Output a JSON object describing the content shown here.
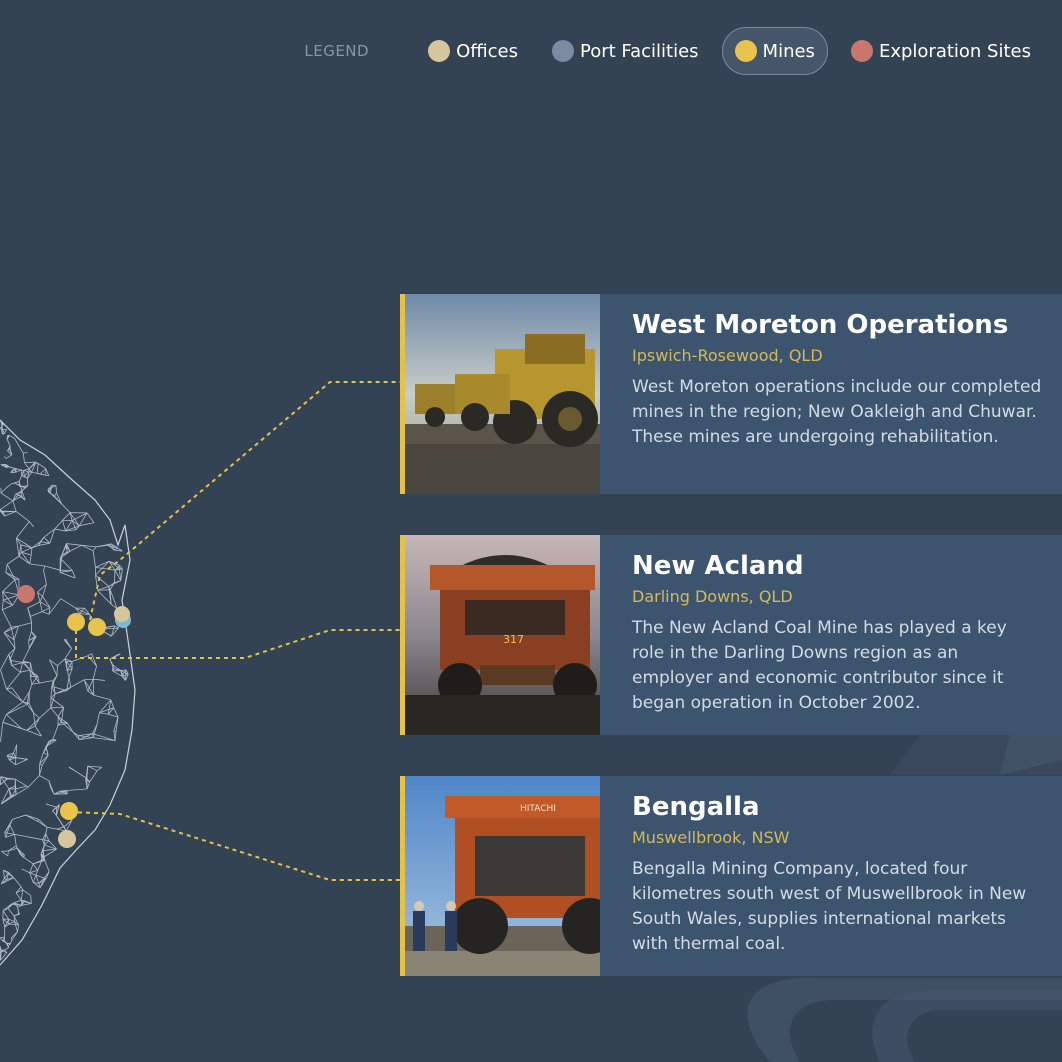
{
  "legend": {
    "title": "LEGEND",
    "items": [
      {
        "label": "Offices",
        "color": "#d6c69b",
        "active": false
      },
      {
        "label": "Port Facilities",
        "color": "#7c8aa3",
        "active": false
      },
      {
        "label": "Mines",
        "color": "#e8c44f",
        "active": true
      },
      {
        "label": "Exploration Sites",
        "color": "#c9776c",
        "active": false
      }
    ]
  },
  "colors": {
    "background": "#344354",
    "card": "#3d546f",
    "accent": "#e4c24a",
    "connector": "#e4c24a"
  },
  "cards": [
    {
      "title": "West Moreton Operations",
      "location": "Ipswich-Rosewood, QLD",
      "description": "West Moreton operations include our completed mines in the region; New Oakleigh and Chuwar. These mines are undergoing rehabilitation.",
      "photo": "haul-trucks-photo"
    },
    {
      "title": "New Acland",
      "location": "Darling Downs, QLD",
      "description": "The New Acland Coal Mine has played a key role in the Darling Downs region as an employer and economic contributor since it began operation in October 2002.",
      "photo": "dump-truck-317-photo"
    },
    {
      "title": "Bengalla",
      "location": "Muswellbrook, NSW",
      "description": "Bengalla Mining Company, located four kilometres south west of Muswellbrook in New South Wales, supplies international markets with thermal coal.",
      "photo": "hitachi-truck-photo",
      "photo_text": "HITACHI"
    }
  ]
}
